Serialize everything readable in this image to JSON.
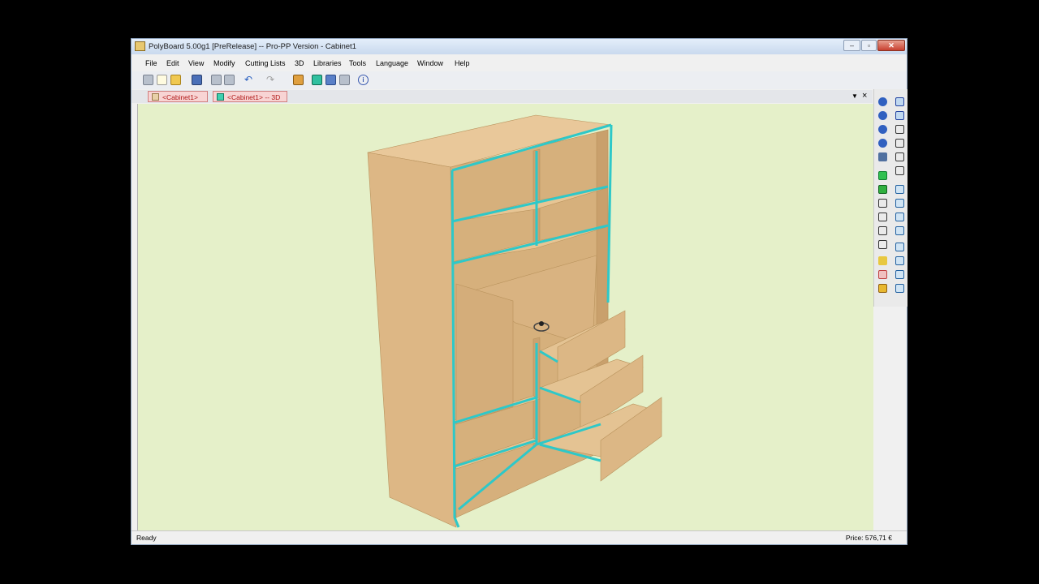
{
  "window": {
    "title": "PolyBoard 5.00g1 [PreRelease] -- Pro-PP Version - Cabinet1"
  },
  "menu": [
    "File",
    "Edit",
    "View",
    "Modify",
    "Cutting Lists",
    "3D",
    "Libraries",
    "Tools",
    "Language",
    "Window",
    "Help"
  ],
  "tabs": [
    "<Cabinet1>",
    "<Cabinet1> -- 3D"
  ],
  "status": {
    "left": "Ready",
    "right": "Price: 576,71 €"
  },
  "colors": {
    "viewport_bg": "#e5f0c9",
    "wood": "#e2bf8e",
    "edge_highlight": "#2ec8c8",
    "tab_text": "#b01818"
  },
  "icons": {
    "toolbar": [
      "new-document-icon",
      "new-page-icon",
      "open-folder-icon",
      "save-icon",
      "print-icon",
      "print-preview-icon",
      "undo-icon",
      "redo-icon",
      "export-icon",
      "3d-view-icon",
      "render-icon",
      "settings-icon",
      "info-icon"
    ],
    "right_toolbar": [
      "rotate-view-icon",
      "green-cube-icon",
      "wireframe-cube-icon",
      "elevation-icon",
      "gold-material-icon"
    ]
  }
}
